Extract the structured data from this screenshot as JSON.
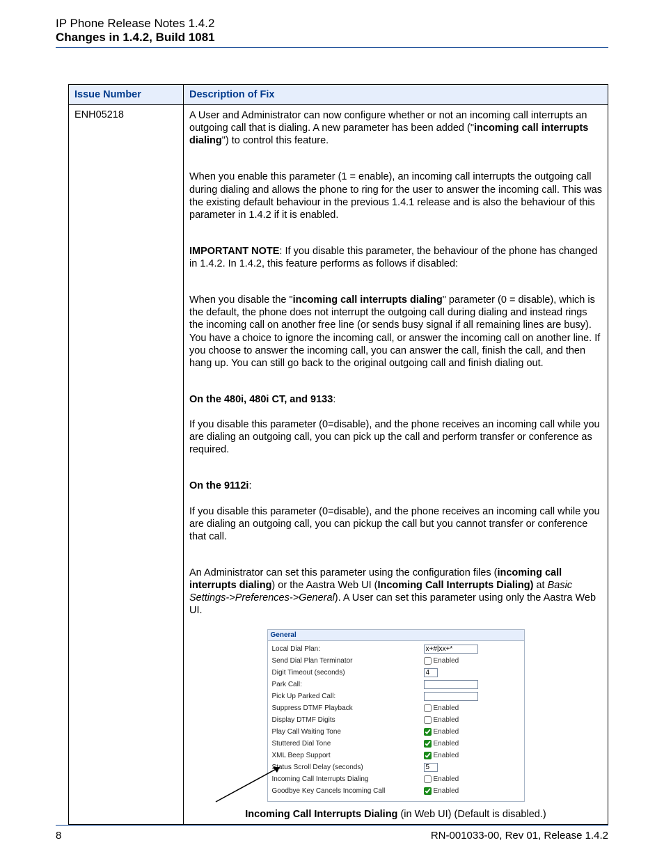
{
  "header": {
    "line1": "IP Phone Release Notes 1.4.2",
    "line2": "Changes in 1.4.2, Build 1081"
  },
  "table": {
    "col_issue": "Issue Number",
    "col_desc": "Description of Fix",
    "issue_number": "ENH05218",
    "p1_a": "A User and Administrator can now configure whether or not an incoming call interrupts an outgoing call that is dialing. A new parameter has been added (\"",
    "p1_bold": "incoming call interrupts dialing",
    "p1_b": "\") to control this feature.",
    "p2": "When you enable this parameter (1 = enable), an incoming call interrupts the outgoing call during dialing and allows the phone to ring for the user to answer the incoming call. This was the existing default behaviour in the previous 1.4.1 release and is also the behaviour of this parameter in 1.4.2 if it is enabled.",
    "p3_bold": "IMPORTANT NOTE",
    "p3_rest": ": If you disable this parameter, the behaviour of the phone has changed in 1.4.2. In 1.4.2, this feature performs as follows if disabled:",
    "p4_a": "When you disable the \"",
    "p4_bold": "incoming call interrupts dialing",
    "p4_b": "\" parameter (0 = disable), which is the default, the phone does not interrupt the outgoing call during dialing and instead rings the incoming call on another free line (or sends busy signal if all remaining lines are busy). You have a choice to ignore the incoming call, or answer the incoming call on another line. If you choose to answer the incoming call, you can answer the call, finish the call, and then hang up. You can still go back to the original outgoing call and finish dialing out.",
    "p5_head": "On the 480i, 480i CT, and 9133",
    "p5_colon": ":",
    "p5_body": "If you disable this parameter (0=disable), and the phone receives an incoming call while you are dialing an outgoing call, you can pick up the call and perform transfer or conference as required.",
    "p6_head": "On the 9112i",
    "p6_colon": ":",
    "p6_body": "If you disable this parameter (0=disable), and the phone receives an incoming call while you are dialing an outgoing call, you can pickup the call but you cannot transfer or conference that call.",
    "p7_a": "An Administrator can set this parameter using the configuration files (",
    "p7_bold1": "incoming call interrupts dialing",
    "p7_b": ") or the Aastra Web UI (",
    "p7_bold2": "Incoming Call Interrupts Dialing)",
    "p7_c": " at ",
    "p7_italic": "Basic Settings->Preferences->General",
    "p7_d": "). A User can set this parameter using only the Aastra Web UI."
  },
  "settings": {
    "title": "General",
    "rows": {
      "local_dial_plan": "Local Dial Plan:",
      "local_dial_plan_value": "x+#|xx+*",
      "send_terminator": "Send Dial Plan Terminator",
      "send_terminator_checked": false,
      "digit_timeout": "Digit Timeout (seconds)",
      "digit_timeout_value": "4",
      "park_call": "Park Call:",
      "park_call_value": "",
      "pickup_parked": "Pick Up Parked Call:",
      "pickup_parked_value": "",
      "suppress_dtmf": "Suppress DTMF Playback",
      "suppress_dtmf_checked": false,
      "display_dtmf": "Display DTMF Digits",
      "display_dtmf_checked": false,
      "call_waiting": "Play Call Waiting Tone",
      "call_waiting_checked": true,
      "stuttered": "Stuttered Dial Tone",
      "stuttered_checked": true,
      "xml_beep": "XML Beep Support",
      "xml_beep_checked": true,
      "scroll_delay": "Status Scroll Delay (seconds)",
      "scroll_delay_value": "5",
      "incoming_interrupt": "Incoming Call Interrupts Dialing",
      "incoming_interrupt_checked": false,
      "goodbye_cancel": "Goodbye Key Cancels Incoming Call",
      "goodbye_cancel_checked": true,
      "enabled_label": "Enabled"
    }
  },
  "caption": {
    "bold": "Incoming Call Interrupts Dialing",
    "rest": " (in Web UI) (Default is disabled.)"
  },
  "footer": {
    "left": "8",
    "right": "RN-001033-00, Rev 01, Release 1.4.2"
  }
}
